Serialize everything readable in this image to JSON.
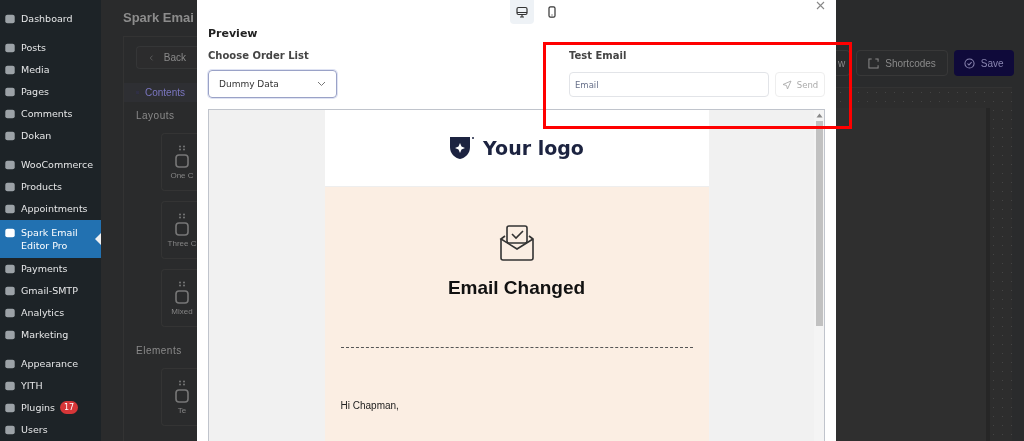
{
  "sidebar": {
    "groups": [
      [
        {
          "label": "Dashboard",
          "selected": false
        }
      ],
      [
        {
          "label": "Posts",
          "selected": false
        },
        {
          "label": "Media",
          "selected": false
        },
        {
          "label": "Pages",
          "selected": false
        },
        {
          "label": "Comments",
          "selected": false
        },
        {
          "label": "Dokan",
          "selected": false
        }
      ],
      [
        {
          "label": "WooCommerce",
          "selected": false
        },
        {
          "label": "Products",
          "selected": false
        },
        {
          "label": "Appointments",
          "selected": false
        },
        {
          "label": "Spark Email Editor Pro",
          "selected": true
        },
        {
          "label": "Payments",
          "selected": false
        },
        {
          "label": "Gmail-SMTP",
          "selected": false
        },
        {
          "label": "Analytics",
          "selected": false
        },
        {
          "label": "Marketing",
          "selected": false
        }
      ],
      [
        {
          "label": "Appearance",
          "selected": false
        },
        {
          "label": "YITH",
          "selected": false
        },
        {
          "label": "Plugins",
          "selected": false,
          "badge": "17"
        },
        {
          "label": "Users",
          "selected": false
        }
      ]
    ]
  },
  "editor": {
    "title": "Spark Emai",
    "back_button": "Back",
    "tab": "Contents",
    "sections": [
      {
        "heading": "Layouts",
        "cards": [
          "One C",
          "Three C",
          "Mixed"
        ]
      },
      {
        "heading": "Elements",
        "cards": [
          "Te"
        ]
      }
    ],
    "toolbar": [
      "w",
      "Shortcodes"
    ],
    "save_button": "Save"
  },
  "modal": {
    "view_modes": [
      {
        "kind": "desktop",
        "selected": true
      },
      {
        "kind": "mobile",
        "selected": false
      }
    ],
    "title": "Preview",
    "order_list": {
      "label": "Choose Order List",
      "value": "Dummy Data"
    },
    "test_email": {
      "label": "Test Email",
      "placeholder": "Email",
      "button": "Send"
    },
    "email": {
      "logo_text": "Your logo",
      "heading": "Email Changed",
      "greeting": "Hi Chapman,"
    }
  }
}
